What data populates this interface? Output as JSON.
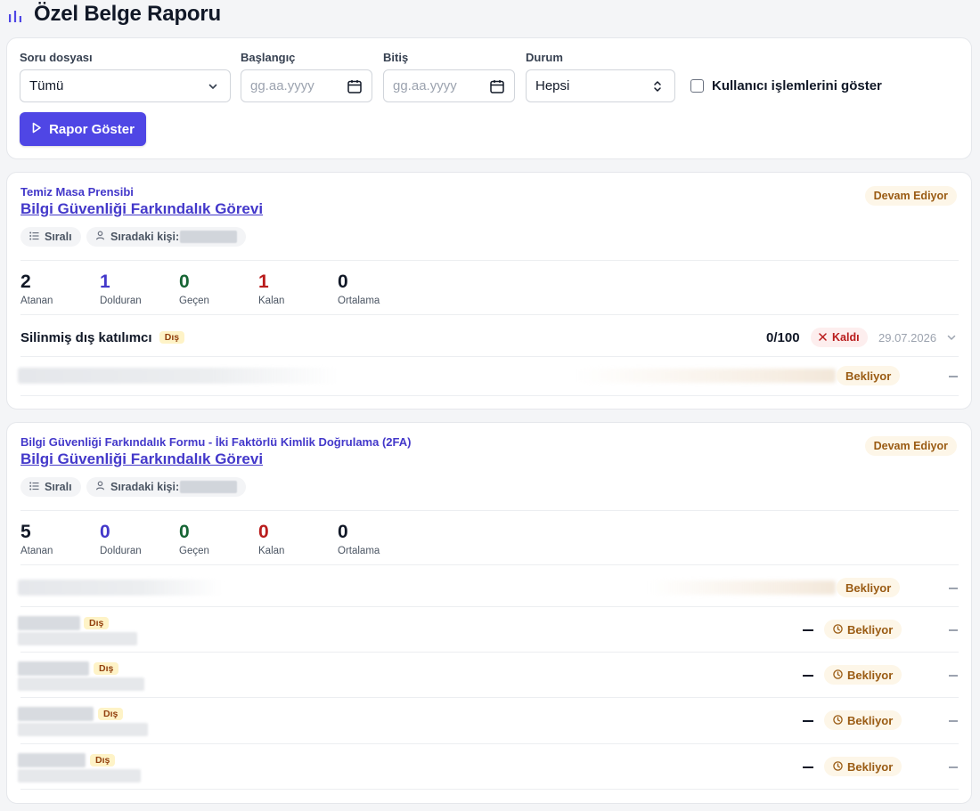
{
  "page": {
    "title": "Özel Belge Raporu",
    "icon": "bar-chart-icon"
  },
  "filters": {
    "form_label": "Soru dosyası",
    "form_value": "Tümü",
    "start_label": "Başlangıç",
    "start_placeholder": "gg.aa.yyyy",
    "end_label": "Bitiş",
    "end_placeholder": "gg.aa.yyyy",
    "status_label": "Durum",
    "status_value": "Hepsi",
    "show_user_ops_label": "Kullanıcı işlemlerini göster",
    "show_user_ops_checked": false,
    "submit_label": "Rapor Göster"
  },
  "tasks": [
    {
      "category": "Temiz Masa Prensibi",
      "title": "Bilgi Güvenliği Farkındalık Görevi",
      "status": "Devam Ediyor",
      "order_chip": "Sıralı",
      "next_person_label": "Sıradaki kişi:",
      "stats": [
        {
          "value": "2",
          "label": "Atanan"
        },
        {
          "value": "1",
          "label": "Dolduran"
        },
        {
          "value": "0",
          "label": "Geçen"
        },
        {
          "value": "1",
          "label": "Kalan"
        },
        {
          "value": "0",
          "label": "Ortalama"
        }
      ],
      "participants": [
        {
          "name": "Silinmiş dış katılımcı",
          "badge": "Dış",
          "score": "0/100",
          "result": "Kaldı",
          "date": "29.07.2026"
        },
        {
          "status": "Bekliyor",
          "trailing": "—"
        }
      ]
    },
    {
      "category": "Bilgi Güvenliği Farkındalık Formu - İki Faktörlü Kimlik Doğrulama (2FA)",
      "title": "Bilgi Güvenliği Farkındalık Görevi",
      "status": "Devam Ediyor",
      "order_chip": "Sıralı",
      "next_person_label": "Sıradaki kişi:",
      "stats": [
        {
          "value": "5",
          "label": "Atanan"
        },
        {
          "value": "0",
          "label": "Dolduran"
        },
        {
          "value": "0",
          "label": "Geçen"
        },
        {
          "value": "0",
          "label": "Kalan"
        },
        {
          "value": "0",
          "label": "Ortalama"
        }
      ],
      "participants": [
        {
          "status": "Bekliyor",
          "trailing": "—"
        },
        {
          "badge": "Dış",
          "score": "—",
          "status": "Bekliyor",
          "trailing": "—"
        },
        {
          "badge": "Dış",
          "score": "—",
          "status": "Bekliyor",
          "trailing": "—"
        },
        {
          "badge": "Dış",
          "score": "—",
          "status": "Bekliyor",
          "trailing": "—"
        },
        {
          "badge": "Dış",
          "score": "—",
          "status": "Bekliyor",
          "trailing": "—"
        }
      ]
    }
  ],
  "colors": {
    "accent": "#4f46e5",
    "link": "#4338ca",
    "pending": "#9a5b13",
    "fail": "#b91c1c",
    "pass": "#166534"
  }
}
